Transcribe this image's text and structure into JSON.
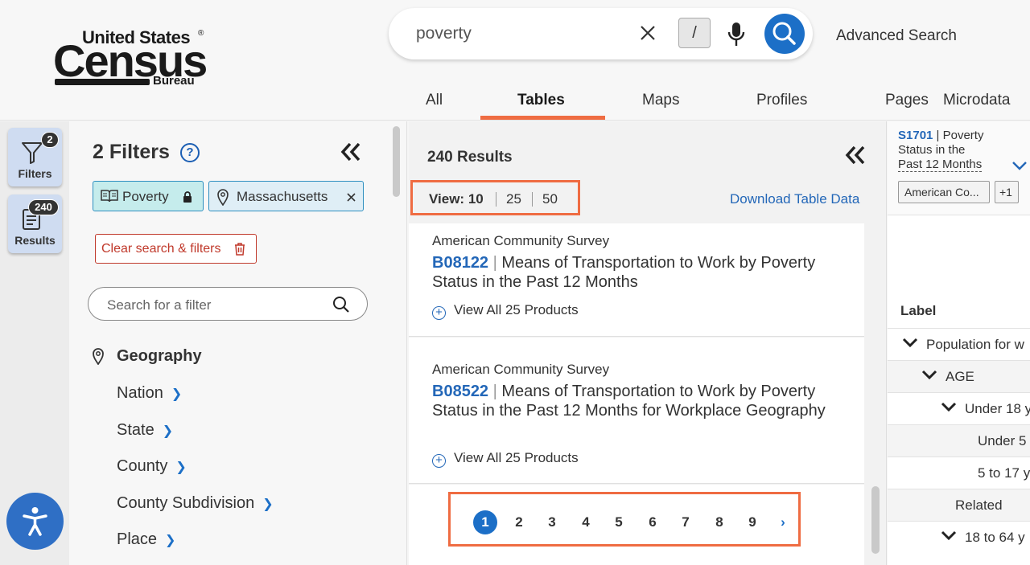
{
  "logo": {
    "line1": "United States",
    "line2": "Census",
    "line3": "Bureau",
    "reg": "®"
  },
  "search": {
    "query": "poverty",
    "slash_key": "/",
    "advanced_label": "Advanced Search"
  },
  "tabs": [
    {
      "label": "All"
    },
    {
      "label": "Tables"
    },
    {
      "label": "Maps"
    },
    {
      "label": "Profiles"
    },
    {
      "label": "Pages"
    },
    {
      "label": "Microdata"
    }
  ],
  "active_tab": "Tables",
  "rail": {
    "filters": {
      "label": "Filters",
      "badge": "2"
    },
    "results": {
      "label": "Results",
      "badge": "240"
    }
  },
  "filters": {
    "title": "2 Filters",
    "help": "?",
    "chips": [
      {
        "label": "Poverty"
      },
      {
        "label": "Massachusetts"
      }
    ],
    "clear_label": "Clear search & filters",
    "search_placeholder": "Search for a filter",
    "geography": {
      "heading": "Geography",
      "items": [
        "Nation",
        "State",
        "County",
        "County Subdivision",
        "Place"
      ]
    }
  },
  "results": {
    "count": "240 Results",
    "view_label": "View: 10",
    "view_options": [
      "25",
      "50"
    ],
    "download_label": "Download Table Data",
    "items": [
      {
        "source": "American Community Survey",
        "code": "B08122",
        "title": "Means of Transportation to Work by Poverty Status in the Past 12 Months",
        "more": "View All 25 Products"
      },
      {
        "source": "American Community Survey",
        "code": "B08522",
        "title": "Means of Transportation to Work by Poverty Status in the Past 12 Months for Workplace Geography",
        "more": "View All 25 Products"
      }
    ],
    "pages": [
      "1",
      "2",
      "3",
      "4",
      "5",
      "6",
      "7",
      "8",
      "9"
    ],
    "current_page": 1
  },
  "table_preview": {
    "code": "S1701",
    "title": "Poverty Status in the Past 12 Months",
    "title_line1": "Poverty",
    "title_line2": "Status in the",
    "title_line3": "Past 12 Months",
    "tags": [
      "American Co...",
      "+1"
    ],
    "label_header": "Label",
    "rows": [
      "Population for w",
      "AGE",
      "Under 18 y",
      "Under 5",
      "5 to 17 y",
      "Related",
      "18 to 64 y"
    ]
  }
}
